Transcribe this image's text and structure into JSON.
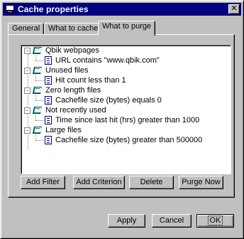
{
  "window": {
    "title": "Cache properties",
    "close_glyph": "✕"
  },
  "tabs": [
    {
      "label": "General"
    },
    {
      "label": "What to cache"
    },
    {
      "label": "What to purge"
    }
  ],
  "tree": {
    "nodes": [
      {
        "label": "Qbik webpages",
        "expander": "-",
        "icon": "book-icon"
      },
      {
        "label": "URL contains \"www.qbik.com\"",
        "icon": "document-icon"
      },
      {
        "label": "Unused files",
        "expander": "-",
        "icon": "book-icon"
      },
      {
        "label": "Hit count less than 1",
        "icon": "document-icon"
      },
      {
        "label": "Zero length files",
        "expander": "-",
        "icon": "book-icon"
      },
      {
        "label": "Cachefile size (bytes) equals 0",
        "icon": "document-icon"
      },
      {
        "label": "Not recently used",
        "expander": "-",
        "icon": "book-icon"
      },
      {
        "label": "Time since last hit (hrs) greater than 1000",
        "icon": "document-icon"
      },
      {
        "label": "Large files",
        "expander": "-",
        "icon": "book-icon"
      },
      {
        "label": "Cachefile size (bytes) greater than 500000",
        "icon": "document-icon"
      }
    ]
  },
  "panel_buttons": {
    "add_filter": "Add Filter",
    "add_criterion": "Add Criterion",
    "delete": "Delete",
    "purge_now": "Purge Now"
  },
  "dialog_buttons": {
    "apply": "Apply",
    "cancel": "Cancel",
    "ok": "OK"
  }
}
